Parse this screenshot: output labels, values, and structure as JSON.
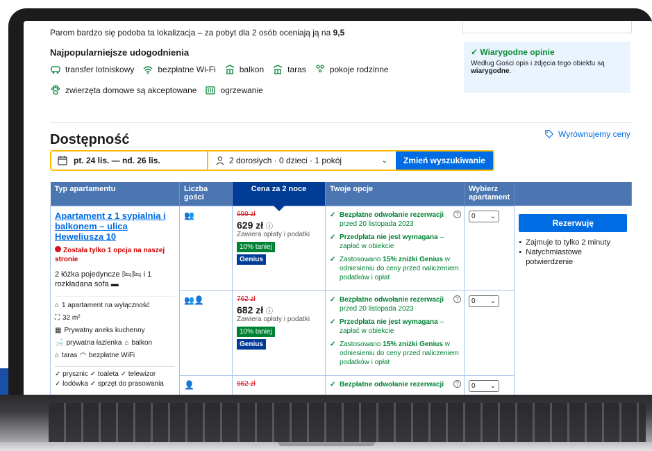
{
  "top_line_prefix": "Parom bardzo się podoba ta lokalizacja – za pobyt dla 2 osób oceniają ją na",
  "top_line_score": "9,5",
  "facilities": {
    "title": "Najpopularniejsze udogodnienia",
    "row1": [
      "transfer lotniskowy",
      "bezpłatne Wi-Fi",
      "balkon",
      "taras",
      "pokoje rodzinne"
    ],
    "row2": [
      "zwierzęta domowe są akceptowane",
      "ogrzewanie"
    ]
  },
  "verified": {
    "title": "Wiarygodne opinie",
    "text": "Według Gości opis i zdjęcia tego obiektu są",
    "bold": "wiarygodne",
    "end": "."
  },
  "availability": {
    "title": "Dostępność",
    "price_match": "Wyrównujemy ceny"
  },
  "search": {
    "dates": "pt. 24 lis. — nd. 26 lis.",
    "guests": "2 dorosłych · 0 dzieci · 1 pokój",
    "button": "Zmień wyszukiwanie"
  },
  "table": {
    "headers": [
      "Typ apartamentu",
      "Liczba gości",
      "Cena za 2 noce",
      "Twoje opcje",
      "Wybierz apartament"
    ],
    "room": {
      "name": "Apartament z 1 sypialnią i balkonem – ulica Heweliusza 10",
      "only_one": "Została tylko 1 opcja na naszej stronie",
      "beds": "2 łóżka pojedyncze",
      "beds2": "i 1",
      "beds3": "rozkładana sofa",
      "amenities": [
        "1 apartament na wyłączność",
        "32 m²",
        "Prywatny aneks kuchenny",
        "prywatna łazienka",
        "balkon",
        "taras",
        "bezpłatne WiFi"
      ],
      "checks": [
        "prysznic",
        "toaleta",
        "telewizor",
        "lodówka",
        "sprzęt do prasowania"
      ]
    },
    "rows": [
      {
        "guests": "●● ",
        "old": "699 zł",
        "new": "629 zł",
        "note": "Zawiera opłaty i podatki",
        "discount": "10% taniej",
        "genius": "Genius",
        "opt1_b": "Bezpłatne odwołanie rezerwacji",
        "opt1": "przed 20 listopada 2023",
        "opt2_b": "Przedpłata nie jest wymagana",
        "opt2": "– zapłać w obiekcie",
        "opt3_pre": "Zastosowano",
        "opt3_b": "15% zniżki Genius",
        "opt3": "w odniesieniu do ceny przed naliczeniem podatków i opłat",
        "select": "0"
      },
      {
        "guests": "●●●",
        "old": "762 zł",
        "new": "682 zł",
        "note": "Zawiera opłaty i podatki",
        "discount": "10% taniej",
        "genius": "Genius",
        "opt1_b": "Bezpłatne odwołanie rezerwacji",
        "opt1": "przed 20 listopada 2023",
        "opt2_b": "Przedpłata nie jest wymagana",
        "opt2": "– zapłać w obiekcie",
        "opt3_pre": "Zastosowano",
        "opt3_b": "15% zniżki Genius",
        "opt3": "w odniesieniu do ceny przed naliczeniem podatków i opłat",
        "select": "0"
      },
      {
        "guests": "●",
        "old": "662 zł",
        "opt1_b": "Bezpłatne odwołanie rezerwacji",
        "select": "0"
      }
    ],
    "reserve": "Rezerwuję",
    "bullets": [
      "Zajmuje to tylko 2 minuty",
      "Natychmiastowe potwierdzenie"
    ]
  },
  "colors": {
    "primary": "#006ce4",
    "header": "#4c76b2",
    "active_header": "#003b95",
    "green": "#008234",
    "red": "#d4111e",
    "accent": "#febb02"
  }
}
